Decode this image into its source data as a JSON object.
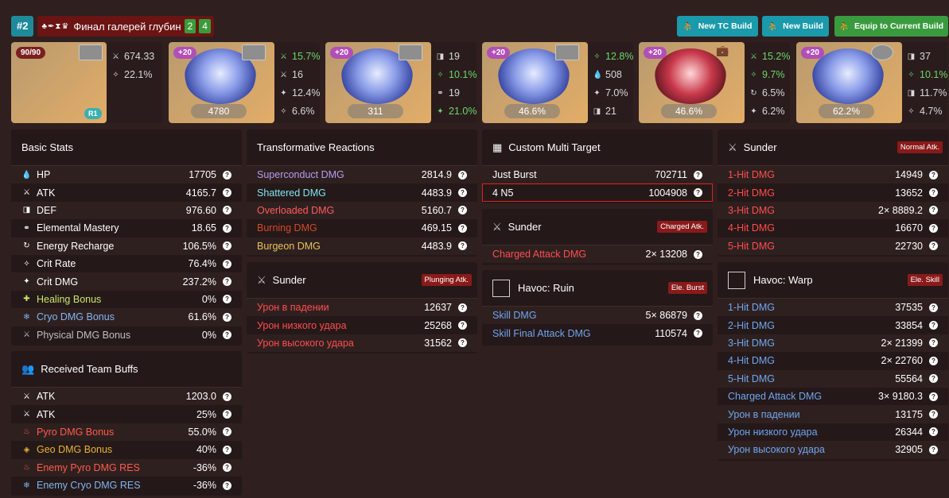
{
  "header": {
    "build_number": "#2",
    "build_name": "Финал галерей глубин",
    "set_icons": "♣✒⧗♛",
    "count_a": "2",
    "count_b": "4",
    "btn_new_tc": "New TC Build",
    "btn_new_build": "New Build",
    "btn_equip": "Equip to Current Build"
  },
  "weapon": {
    "level": "90/90",
    "refine": "R1",
    "atk": "674.33",
    "sub": "22.1%"
  },
  "artifacts": [
    {
      "level": "+20",
      "main": "4780",
      "subs": [
        "15.7%",
        "16",
        "12.4%",
        "6.6%"
      ]
    },
    {
      "level": "+20",
      "main": "311",
      "subs": [
        "19",
        "10.1%",
        "19",
        "21.0%"
      ]
    },
    {
      "level": "+20",
      "main": "46.6%",
      "subs": [
        "12.8%",
        "508",
        "7.0%",
        "21"
      ]
    },
    {
      "level": "+20",
      "main": "46.6%",
      "subs": [
        "15.2%",
        "9.7%",
        "6.5%",
        "6.2%"
      ]
    },
    {
      "level": "+20",
      "main": "62.2%",
      "subs": [
        "37",
        "10.1%",
        "11.7%",
        "4.7%"
      ]
    }
  ],
  "basic_stats": {
    "title": "Basic Stats",
    "rows": [
      {
        "label": "HP",
        "value": "17705"
      },
      {
        "label": "ATK",
        "value": "4165.7"
      },
      {
        "label": "DEF",
        "value": "976.60"
      },
      {
        "label": "Elemental Mastery",
        "value": "18.65"
      },
      {
        "label": "Energy Recharge",
        "value": "106.5%"
      },
      {
        "label": "Crit Rate",
        "value": "76.4%"
      },
      {
        "label": "Crit DMG",
        "value": "237.2%"
      },
      {
        "label": "Healing Bonus",
        "value": "0%"
      },
      {
        "label": "Cryo DMG Bonus",
        "value": "61.6%"
      },
      {
        "label": "Physical DMG Bonus",
        "value": "0%"
      }
    ]
  },
  "team_buffs": {
    "title": "Received Team Buffs",
    "rows": [
      {
        "label": "ATK",
        "value": "1203.0"
      },
      {
        "label": "ATK",
        "value": "25%"
      },
      {
        "label": "Pyro DMG Bonus",
        "value": "55.0%"
      },
      {
        "label": "Geo DMG Bonus",
        "value": "40%"
      },
      {
        "label": "Enemy Pyro DMG RES",
        "value": "-36%"
      },
      {
        "label": "Enemy Cryo DMG RES",
        "value": "-36%"
      }
    ]
  },
  "transformative": {
    "title": "Transformative Reactions",
    "rows": [
      {
        "label": "Superconduct DMG",
        "value": "2814.9"
      },
      {
        "label": "Shattered DMG",
        "value": "4483.9"
      },
      {
        "label": "Overloaded DMG",
        "value": "5160.7"
      },
      {
        "label": "Burning DMG",
        "value": "469.15"
      },
      {
        "label": "Burgeon DMG",
        "value": "4483.9"
      }
    ]
  },
  "sunder_plunge": {
    "title": "Sunder",
    "tag": "Plunging Atk.",
    "rows": [
      {
        "label": "Урон в падении",
        "value": "12637"
      },
      {
        "label": "Урон низкого удара",
        "value": "25268"
      },
      {
        "label": "Урон высокого удара",
        "value": "31562"
      }
    ]
  },
  "custom_multi": {
    "title": "Custom Multi Target",
    "rows": [
      {
        "label": "Just Burst",
        "value": "702711"
      },
      {
        "label": "4 N5",
        "value": "1004908"
      }
    ]
  },
  "sunder_charged": {
    "title": "Sunder",
    "tag": "Charged Atk.",
    "rows": [
      {
        "label": "Charged Attack DMG",
        "value": "2× 13208"
      }
    ]
  },
  "havoc_ruin": {
    "title": "Havoc: Ruin",
    "tag": "Ele. Burst",
    "rows": [
      {
        "label": "Skill DMG",
        "value": "5× 86879"
      },
      {
        "label": "Skill Final Attack DMG",
        "value": "110574"
      }
    ]
  },
  "sunder_normal": {
    "title": "Sunder",
    "tag": "Normal Atk.",
    "rows": [
      {
        "label": "1-Hit DMG",
        "value": "14949"
      },
      {
        "label": "2-Hit DMG",
        "value": "13652"
      },
      {
        "label": "3-Hit DMG",
        "value": "2× 8889.2"
      },
      {
        "label": "4-Hit DMG",
        "value": "16670"
      },
      {
        "label": "5-Hit DMG",
        "value": "22730"
      }
    ]
  },
  "havoc_warp": {
    "title": "Havoc: Warp",
    "tag": "Ele. Skill",
    "rows": [
      {
        "label": "1-Hit DMG",
        "value": "37535"
      },
      {
        "label": "2-Hit DMG",
        "value": "33854"
      },
      {
        "label": "3-Hit DMG",
        "value": "2× 21399"
      },
      {
        "label": "4-Hit DMG",
        "value": "2× 22760"
      },
      {
        "label": "5-Hit DMG",
        "value": "55564"
      },
      {
        "label": "Charged Attack DMG",
        "value": "3× 9180.3"
      },
      {
        "label": "Урон в падении",
        "value": "13175"
      },
      {
        "label": "Урон низкого удара",
        "value": "26344"
      },
      {
        "label": "Урон высокого удара",
        "value": "32905"
      }
    ]
  },
  "colors": {
    "accent_teal": "#1a9aaa",
    "accent_green": "#3a9b3e",
    "bg": "#301f1f",
    "tag_red": "#8a1a1a"
  }
}
